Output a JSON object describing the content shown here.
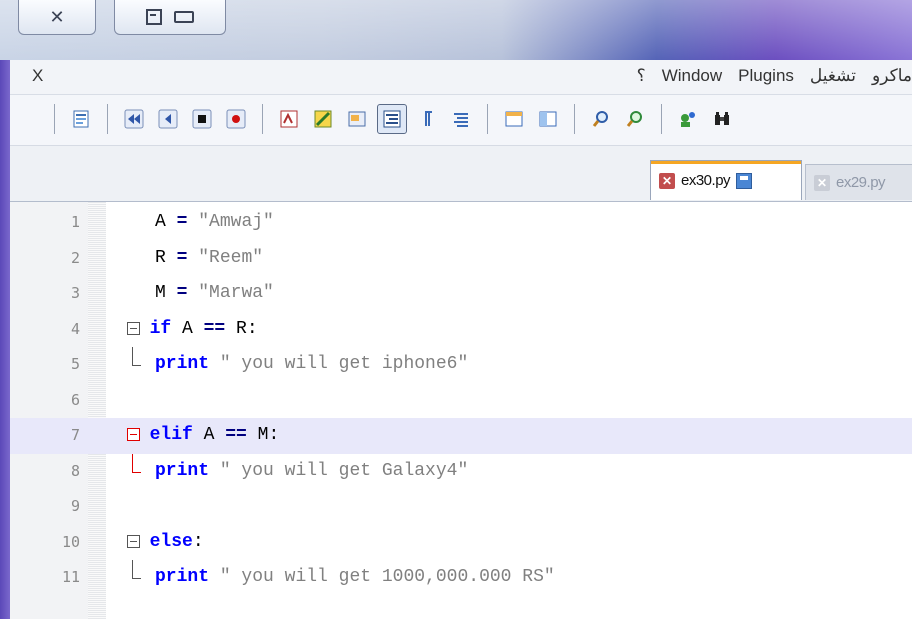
{
  "window": {
    "controls": [
      "close",
      "restore",
      "minimize"
    ]
  },
  "menubar": {
    "left_item": "X",
    "items": [
      "؟",
      "Window",
      "Plugins",
      "تشغيل",
      "ماكرو"
    ]
  },
  "tabs": [
    {
      "label": "ex30.py",
      "active": true
    },
    {
      "label": "ex29.py",
      "active": false
    }
  ],
  "editor": {
    "current_line": 7,
    "lines": [
      {
        "n": "1",
        "text": "A = \"Amwaj\""
      },
      {
        "n": "2",
        "text": "R = \"Reem\""
      },
      {
        "n": "3",
        "text": "M = \"Marwa\""
      },
      {
        "n": "4",
        "text": "if A == R:"
      },
      {
        "n": "5",
        "text": " print \" you will get iphone6\""
      },
      {
        "n": "6",
        "text": ""
      },
      {
        "n": "7",
        "text": "elif A == M:"
      },
      {
        "n": "8",
        "text": " print \" you will get Galaxy4\""
      },
      {
        "n": "9",
        "text": ""
      },
      {
        "n": "10",
        "text": "else:"
      },
      {
        "n": "11",
        "text": " print \" you will get 1000,000.000 RS\""
      }
    ]
  },
  "colors": {
    "keyword": "#0000ff",
    "string": "#808080",
    "current_line": "#e8e8fa",
    "fold_active": "#e00000",
    "tab_accent": "#f5a623"
  }
}
